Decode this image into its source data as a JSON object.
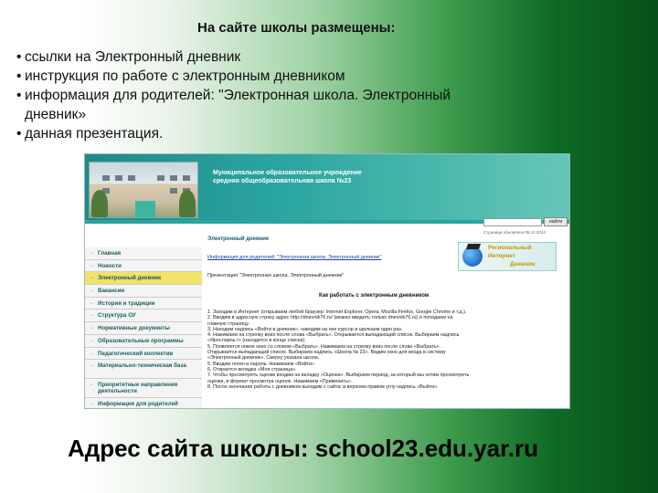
{
  "slide": {
    "title": "На сайте школы размещены:",
    "bullets": [
      "ссылки на Электронный дневник",
      "инструкция по работе с электронным дневником",
      "информация для родителей: \"Электронная школа. Электронный",
      "дневник»",
      "данная презентация."
    ],
    "footer": "Адрес сайта школы: school23.edu.yar.ru"
  },
  "site": {
    "header_title_line1": "Муниципальное образовательное учреждение",
    "header_title_line2": "средняя общеобразовательная школа №23",
    "search_button": "найти",
    "update_date": "Страница обновлена 05.12.2012",
    "menu": [
      "Главная",
      "Новости",
      "Электронный дневник",
      "Вакансии",
      "История и традиции",
      "Структура ОУ",
      "Нормативные документы",
      "Образовательные программы",
      "Педагогический коллектив",
      "Материально-техническая база",
      "Приоритетные направления деятельности",
      "Информация для родителей"
    ],
    "content": {
      "heading": "Электронный дневник",
      "link": "Информация для родителей: \"Электронная школа. Электронный дневник\"",
      "presentation": "Презентация \"Электронная школа. Электронный дневник\"",
      "subheading": "Как работать с электронным дневником",
      "steps": [
        "1. Заходим в Интернет (открываем любой браузер: Internet Explorer, Opera, Mozilla Firefox, Google Chrome и т.д.).",
        "2. Вводим в адресную строку адрес http://dnevnik76.ru/ (можно вводить только dnevnik76.ru) и попадаем на",
        "главную страницу.",
        "3. Находим надпись «Войти в дневник», наводим на нее курсор и щелкаем один раз.",
        "4. Нажимаем на стрелку вниз после слова «Выбрать». Открывается выпадающий список. Выбираем надпись",
        "«Ярославль г» (находится в конце списка).",
        "5. Появляется новое окно со словом «Выбрать». Нажимаем на стрелку вниз после слова «Выбрать».",
        "Открывается выпадающий список. Выбираем надпись «Школа № 23». Видим окно для входа в систему",
        "«Электронный дневник». Сверху указана школа.",
        "5. Вводим логин и пароль. Нажимаем «Войти»",
        "6. Открается вкладка «Моя страница».",
        "7. Чтобы просмотреть оценки входим на вкладку «Оценки». Выбираем период, за который мы хотим просмотреть",
        "оценки, и формат просмотра оценок. Нажимаем «Применить».",
        "8. После окончания работы с дневником выходим с сайта: в верхнем правом углу надпись «Выйти»."
      ]
    },
    "banner": {
      "line1": "Региональный",
      "line2": "Интернет",
      "line3": "Дневник"
    }
  }
}
